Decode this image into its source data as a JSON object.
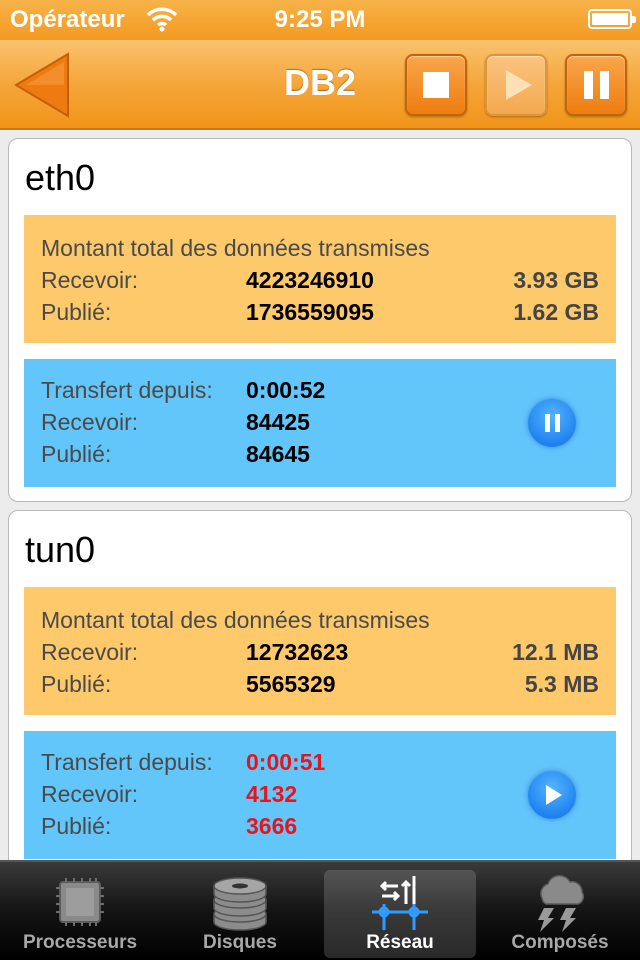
{
  "status_bar": {
    "carrier": "Opérateur",
    "time": "9:25 PM"
  },
  "nav": {
    "title": "DB2",
    "buttons": [
      "stop",
      "play",
      "pause"
    ]
  },
  "interfaces": [
    {
      "name": "eth0",
      "totals": {
        "heading": "Montant total des données transmises",
        "receive_label": "Recevoir:",
        "receive_bytes": "4223246910",
        "receive_size": "3.93 GB",
        "sent_label": "Publié:",
        "sent_bytes": "1736559095",
        "sent_size": "1.62 GB"
      },
      "transfer": {
        "since_label": "Transfert depuis:",
        "since_value": "0:00:52",
        "receive_label": "Recevoir:",
        "receive_value": "84425",
        "sent_label": "Publié:",
        "sent_value": "84645",
        "state": "running",
        "button": "pause"
      }
    },
    {
      "name": "tun0",
      "totals": {
        "heading": "Montant total des données transmises",
        "receive_label": "Recevoir:",
        "receive_bytes": "12732623",
        "receive_size": "12.1 MB",
        "sent_label": "Publié:",
        "sent_bytes": "5565329",
        "sent_size": "5.3 MB"
      },
      "transfer": {
        "since_label": "Transfert depuis:",
        "since_value": "0:00:51",
        "receive_label": "Recevoir:",
        "receive_value": "4132",
        "sent_label": "Publié:",
        "sent_value": "3666",
        "state": "paused",
        "button": "play"
      }
    }
  ],
  "tabs": [
    {
      "label": "Processeurs",
      "icon": "cpu-chip-icon",
      "active": false
    },
    {
      "label": "Disques",
      "icon": "disk-stack-icon",
      "active": false
    },
    {
      "label": "Réseau",
      "icon": "network-icon",
      "active": true
    },
    {
      "label": "Composés",
      "icon": "storm-cloud-icon",
      "active": false
    }
  ],
  "colors": {
    "bar_orange": "#f5a63a",
    "totals_panel": "#fec96b",
    "transfer_panel": "#63c6fb",
    "paused_value": "#e8141b",
    "action_button": "#0a6fe8"
  }
}
